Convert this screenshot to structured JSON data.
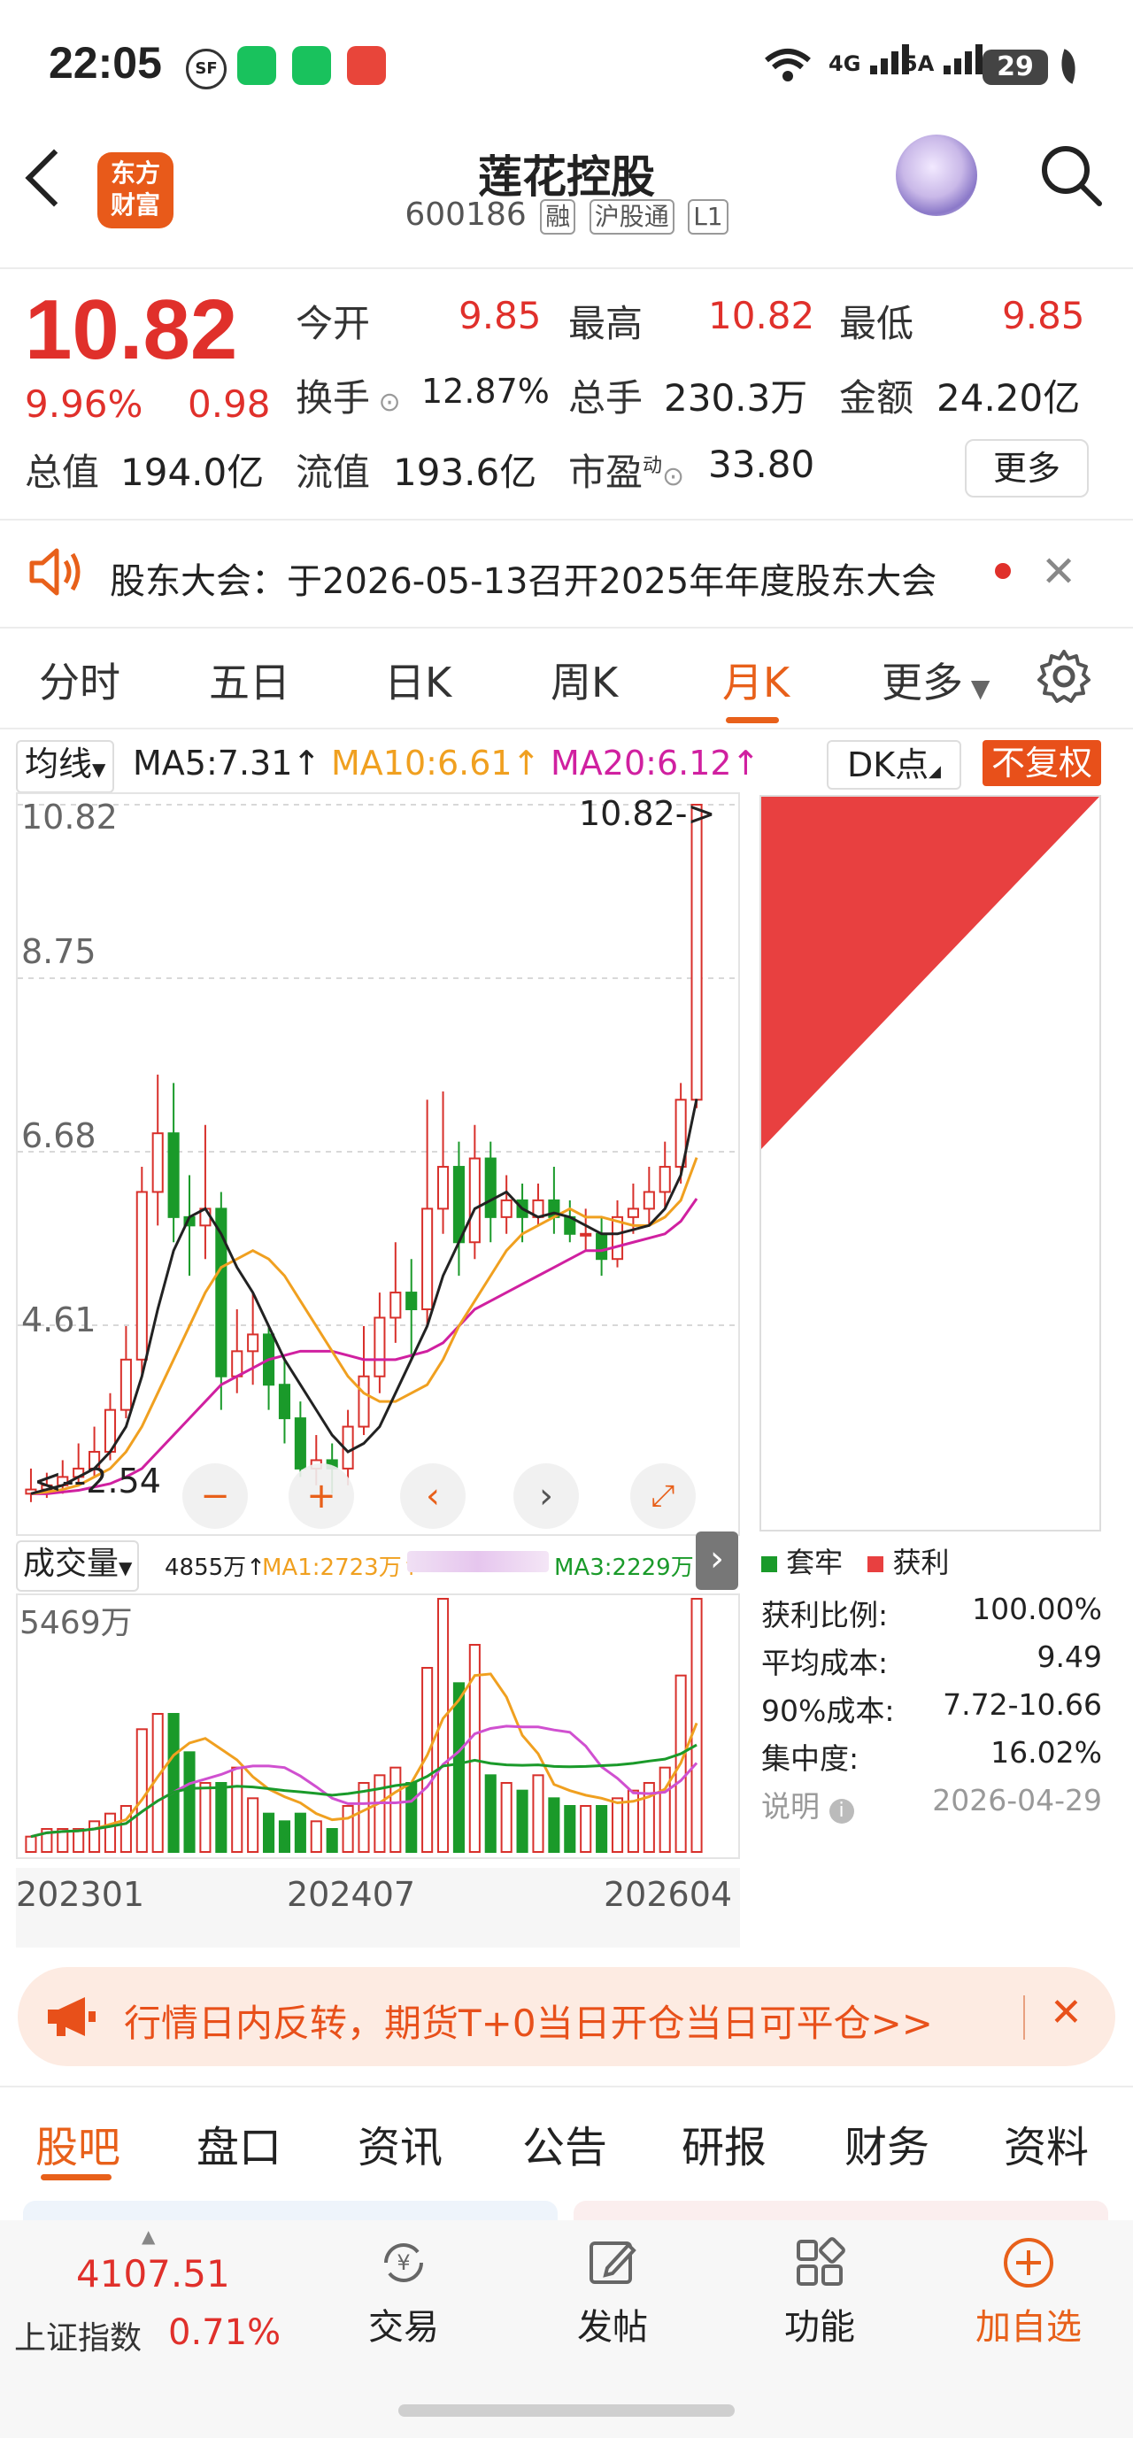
{
  "status_bar": {
    "time": "22:05",
    "network_4g": "4G",
    "network_5a": "5A",
    "battery": "29"
  },
  "header": {
    "logo_text": "东方财富",
    "stock_name": "莲花控股",
    "stock_code": "600186",
    "tags": [
      "融",
      "沪股通",
      "L1"
    ]
  },
  "quote": {
    "price": "10.82",
    "change_pct": "9.96%",
    "change_amt": "0.98",
    "fields": [
      {
        "label": "今开",
        "value": "9.85"
      },
      {
        "label": "最高",
        "value": "10.82"
      },
      {
        "label": "最低",
        "value": "9.85"
      },
      {
        "label": "换手",
        "value": "12.87%"
      },
      {
        "label": "总手",
        "value": "230.3万"
      },
      {
        "label": "金额",
        "value": "24.20亿"
      },
      {
        "label": "总值",
        "value": "194.0亿"
      },
      {
        "label": "流值",
        "value": "193.6亿"
      },
      {
        "label": "市盈",
        "sup": "动",
        "value": "33.80"
      }
    ],
    "more_button": "更多"
  },
  "notice": {
    "text": "股东大会：于2026-05-13召开2025年年度股东大会"
  },
  "chart_tabs": [
    "分时",
    "五日",
    "日K",
    "周K",
    "月K",
    "更多"
  ],
  "active_chart_tab": "月K",
  "ma_bar": {
    "selector": "均线",
    "ma5": "MA5:7.31↑",
    "ma10": "MA10:6.61↑",
    "ma20": "MA20:6.12↑",
    "dk": "DK点",
    "adjust": "不复权"
  },
  "price_axis": [
    "10.82",
    "8.75",
    "6.68",
    "4.61",
    "2.54"
  ],
  "price_marker": "10.82->",
  "low_marker": "2.54",
  "volume_bar": {
    "selector": "成交量",
    "vol": "4855万↑",
    "ma1": "MA1:2723万↑",
    "ma3": "MA3:2229万↑",
    "max_label": "5469万"
  },
  "date_axis": [
    "202301",
    "202407",
    "202604"
  ],
  "chip": {
    "legend_hold": "套牢",
    "legend_profit": "获利",
    "rows": [
      {
        "label": "获利比例:",
        "value": "100.00%"
      },
      {
        "label": "平均成本:",
        "value": "9.49"
      },
      {
        "label": "90%成本:",
        "value": "7.72-10.66"
      },
      {
        "label": "集中度:",
        "value": "16.02%"
      }
    ],
    "note_label": "说明",
    "note_date": "2026-04-29"
  },
  "ad": {
    "text": "行情日内反转，期货T+0当日开仓当日可平仓>>"
  },
  "bottom_tabs": [
    "股吧",
    "盘口",
    "资讯",
    "公告",
    "研报",
    "财务",
    "资料"
  ],
  "active_bottom_tab": "股吧",
  "index": {
    "value": "4107.51",
    "name": "上证指数",
    "pct": "0.71%"
  },
  "nav": [
    {
      "label": "交易",
      "icon": "yen-exchange-icon"
    },
    {
      "label": "发帖",
      "icon": "edit-icon"
    },
    {
      "label": "功能",
      "icon": "grid-icon"
    },
    {
      "label": "加自选",
      "icon": "add-circle-icon"
    }
  ],
  "colors": {
    "up": "#e0302b",
    "down": "#1a9a2a",
    "accent": "#e8601a",
    "ma5": "#222222",
    "ma10": "#f0a020",
    "ma20": "#d020a0"
  },
  "chart_data": {
    "type": "candlestick",
    "period": "monthly",
    "x_labels": [
      "202301",
      "202407",
      "202604"
    ],
    "ylim": [
      2.54,
      10.82
    ],
    "candles": [
      [
        2.6,
        2.65,
        2.5,
        2.9
      ],
      [
        2.65,
        2.7,
        2.55,
        2.85
      ],
      [
        2.7,
        2.8,
        2.6,
        3.0
      ],
      [
        2.8,
        2.9,
        2.7,
        3.2
      ],
      [
        2.9,
        3.1,
        2.8,
        3.4
      ],
      [
        3.1,
        3.6,
        3.0,
        3.8
      ],
      [
        3.6,
        4.2,
        3.5,
        4.6
      ],
      [
        4.2,
        6.2,
        4.0,
        6.5
      ],
      [
        6.2,
        6.9,
        5.8,
        7.6
      ],
      [
        6.9,
        5.9,
        5.6,
        7.5
      ],
      [
        5.9,
        5.8,
        5.2,
        6.4
      ],
      [
        5.8,
        6.0,
        5.4,
        7.0
      ],
      [
        6.0,
        4.0,
        3.6,
        6.2
      ],
      [
        4.0,
        4.3,
        3.8,
        4.8
      ],
      [
        4.3,
        4.5,
        3.9,
        5.0
      ],
      [
        4.5,
        3.9,
        3.6,
        4.6
      ],
      [
        3.9,
        3.5,
        3.2,
        4.2
      ],
      [
        3.5,
        2.9,
        2.8,
        3.7
      ],
      [
        2.9,
        3.0,
        2.7,
        3.3
      ],
      [
        3.0,
        2.9,
        2.6,
        3.2
      ],
      [
        2.9,
        3.4,
        2.7,
        3.6
      ],
      [
        3.4,
        4.0,
        3.3,
        4.6
      ],
      [
        4.0,
        4.7,
        3.8,
        5.0
      ],
      [
        4.7,
        5.0,
        4.4,
        5.6
      ],
      [
        5.0,
        4.8,
        4.2,
        5.4
      ],
      [
        4.8,
        6.0,
        4.6,
        7.3
      ],
      [
        6.0,
        6.5,
        5.7,
        7.4
      ],
      [
        6.5,
        5.6,
        5.2,
        6.8
      ],
      [
        5.6,
        6.6,
        5.4,
        7.0
      ],
      [
        6.6,
        5.9,
        5.6,
        6.8
      ],
      [
        5.9,
        6.1,
        5.7,
        6.4
      ],
      [
        6.1,
        5.9,
        5.6,
        6.3
      ],
      [
        5.9,
        6.1,
        5.8,
        6.3
      ],
      [
        6.1,
        5.9,
        5.7,
        6.5
      ],
      [
        5.9,
        5.7,
        5.6,
        6.1
      ],
      [
        5.7,
        5.7,
        5.5,
        6.0
      ],
      [
        5.7,
        5.4,
        5.2,
        5.9
      ],
      [
        5.4,
        5.9,
        5.3,
        6.1
      ],
      [
        5.9,
        6.0,
        5.7,
        6.3
      ],
      [
        6.0,
        6.2,
        5.8,
        6.5
      ],
      [
        6.2,
        6.5,
        6.0,
        6.8
      ],
      [
        6.5,
        7.3,
        6.3,
        7.5
      ],
      [
        7.3,
        10.82,
        7.2,
        10.82
      ]
    ],
    "ma5": [
      2.6,
      2.65,
      2.7,
      2.8,
      2.9,
      3.1,
      3.4,
      4.0,
      4.8,
      5.5,
      5.9,
      6.0,
      5.7,
      5.3,
      5.0,
      4.6,
      4.2,
      3.9,
      3.6,
      3.3,
      3.1,
      3.2,
      3.4,
      3.8,
      4.2,
      4.6,
      5.2,
      5.6,
      6.0,
      6.1,
      6.2,
      6.0,
      5.9,
      5.95,
      5.9,
      5.8,
      5.7,
      5.7,
      5.75,
      5.8,
      6.0,
      6.4,
      7.31
    ],
    "ma10": [
      2.6,
      2.62,
      2.65,
      2.7,
      2.8,
      2.9,
      3.1,
      3.4,
      3.8,
      4.2,
      4.6,
      5.0,
      5.3,
      5.4,
      5.5,
      5.4,
      5.2,
      4.9,
      4.6,
      4.3,
      4.0,
      3.8,
      3.7,
      3.7,
      3.8,
      3.9,
      4.2,
      4.6,
      4.9,
      5.2,
      5.5,
      5.7,
      5.8,
      5.9,
      6.0,
      5.9,
      5.9,
      5.85,
      5.8,
      5.8,
      5.9,
      6.1,
      6.61
    ],
    "ma20": [
      2.6,
      2.6,
      2.62,
      2.64,
      2.68,
      2.72,
      2.8,
      2.9,
      3.1,
      3.3,
      3.5,
      3.7,
      3.9,
      4.0,
      4.1,
      4.2,
      4.25,
      4.3,
      4.3,
      4.3,
      4.25,
      4.2,
      4.2,
      4.2,
      4.25,
      4.3,
      4.4,
      4.6,
      4.8,
      4.9,
      5.0,
      5.1,
      5.2,
      5.3,
      5.4,
      5.5,
      5.5,
      5.55,
      5.6,
      5.65,
      5.7,
      5.85,
      6.12
    ],
    "volume": [
      2,
      3,
      3,
      3,
      4,
      5,
      6,
      16,
      18,
      18,
      13,
      9,
      9,
      11,
      7,
      5,
      4,
      5,
      4,
      3,
      6,
      9,
      10,
      11,
      9,
      24,
      33,
      22,
      27,
      10,
      9,
      8,
      10,
      7,
      6,
      6,
      6,
      7,
      8,
      9,
      11,
      23,
      33
    ],
    "volume_max": 5469
  }
}
